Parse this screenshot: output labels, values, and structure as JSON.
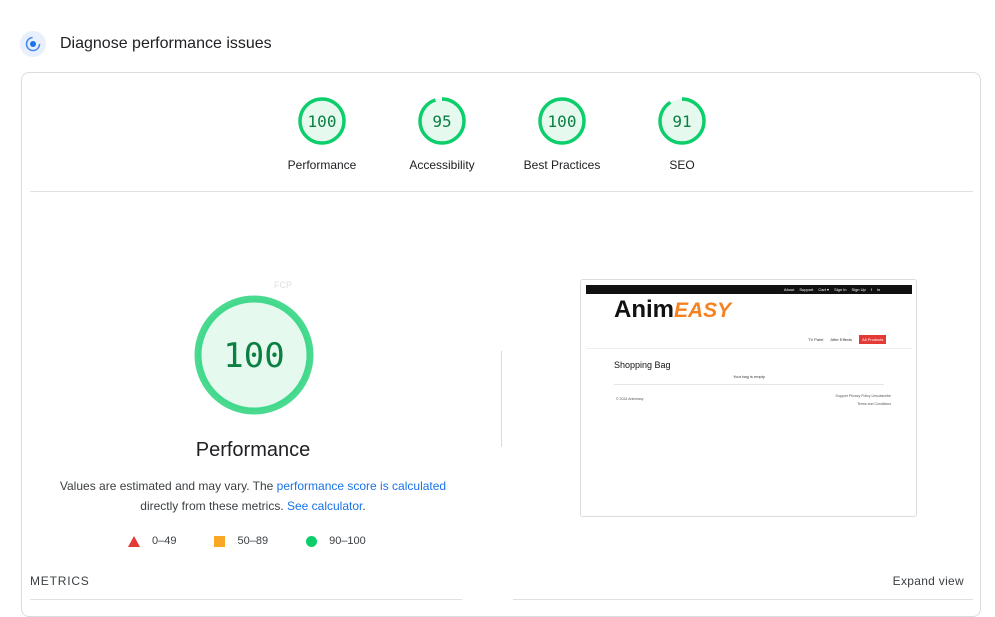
{
  "section": {
    "title": "Diagnose performance issues",
    "icon": "lighthouse-icon"
  },
  "categories": [
    {
      "label": "Performance",
      "score": "100",
      "value": 100
    },
    {
      "label": "Accessibility",
      "score": "95",
      "value": 95
    },
    {
      "label": "Best Practices",
      "score": "100",
      "value": 100
    },
    {
      "label": "SEO",
      "score": "91",
      "value": 91
    }
  ],
  "main_gauge": {
    "score": "100",
    "value": 100,
    "title": "Performance",
    "fcp_label": "FCP"
  },
  "description": {
    "text1": "Values are estimated and may vary. The ",
    "link1": "performance score is calculated",
    "text2": "directly from these metrics. ",
    "link2": "See calculator",
    "text3": "."
  },
  "legend": [
    {
      "shape": "triangle",
      "color": "#e53935",
      "range": "0–49"
    },
    {
      "shape": "square",
      "color": "#f9a825",
      "range": "50–89"
    },
    {
      "shape": "circle",
      "color": "#0cce6b",
      "range": "90–100"
    }
  ],
  "metrics": {
    "label": "METRICS",
    "expand": "Expand view"
  },
  "screenshot": {
    "top_links": [
      "About",
      "Support",
      "Cart ▾",
      "Sign In",
      "Sign Up",
      "f",
      "in"
    ],
    "logo_main": "Anim",
    "logo_accent": "EASY",
    "nav": [
      "TV Paint",
      "After Effects"
    ],
    "nav_button": "All Products",
    "heading": "Shopping Bag",
    "empty": "Your bag is empty",
    "copyright": "© 2024 Animeasy",
    "footer_links": "Support  Privacy Policy  Unsubscribe",
    "footer_terms": "Terms and Conditions"
  },
  "colors": {
    "good": "#0cce6b",
    "good_fill": "#e6f9ee",
    "good_text": "#0b8043",
    "accent_link": "#1a73e8"
  }
}
